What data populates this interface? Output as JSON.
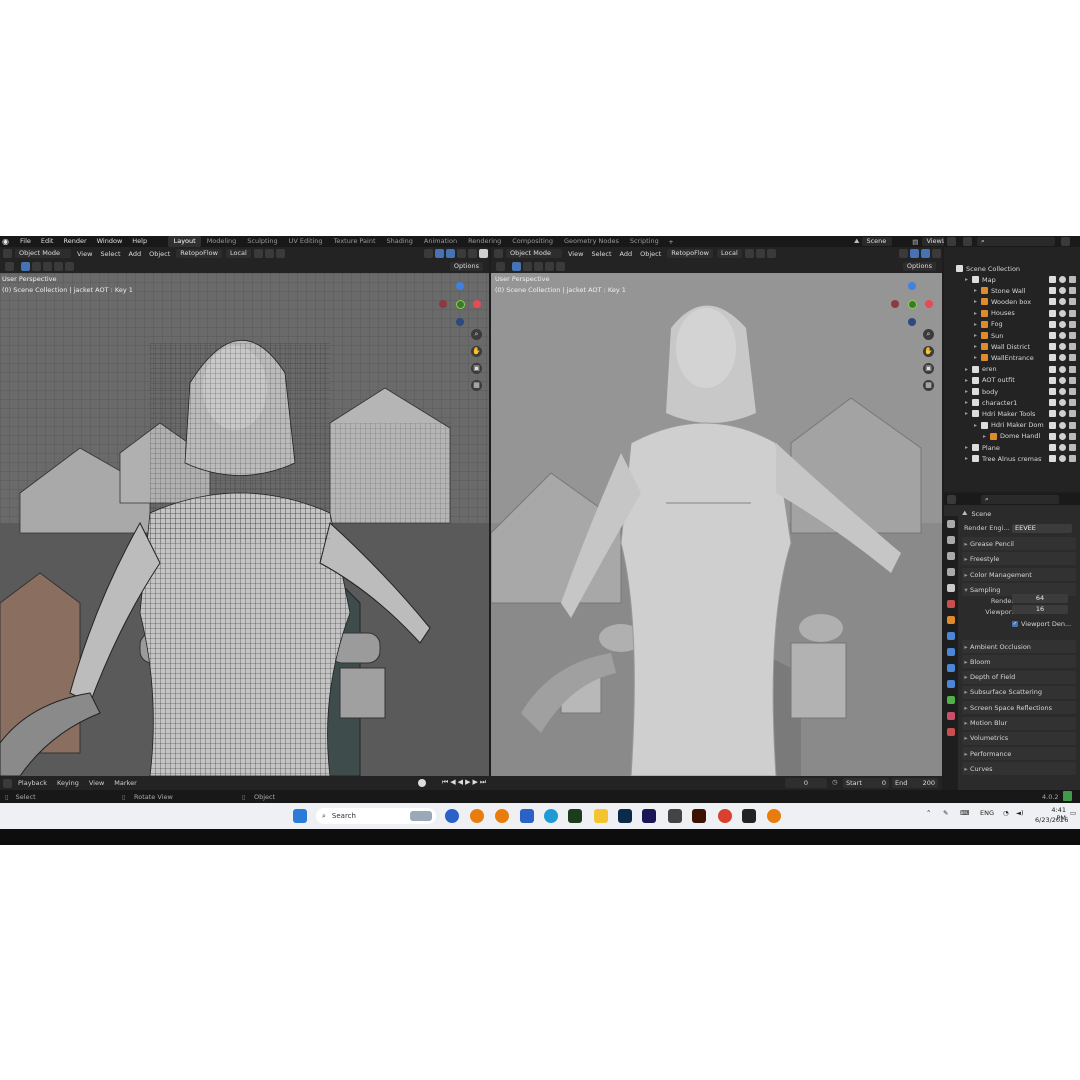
{
  "menu": {
    "items": [
      "File",
      "Edit",
      "Render",
      "Window",
      "Help"
    ],
    "workspaces": [
      "Layout",
      "Modeling",
      "Sculpting",
      "UV Editing",
      "Texture Paint",
      "Shading",
      "Animation",
      "Rendering",
      "Compositing",
      "Geometry Nodes",
      "Scripting"
    ],
    "active_workspace": "Layout",
    "add": "+",
    "scene": "Scene",
    "view_layer": "ViewLayer"
  },
  "viewport_left": {
    "mode": "Object Mode",
    "menu": [
      "View",
      "Select",
      "Add",
      "Object"
    ],
    "addon": "RetopoFlow",
    "transform": "Local",
    "options": "Options",
    "title": "User Perspective",
    "subtitle": "(0) Scene Collection | jacket AOT : Key 1"
  },
  "viewport_right": {
    "mode": "Object Mode",
    "menu": [
      "View",
      "Select",
      "Add",
      "Object"
    ],
    "addon": "RetopoFlow",
    "transform": "Local",
    "options": "Options",
    "title": "User Perspective",
    "subtitle": "(0) Scene Collection | jacket AOT : Key 1"
  },
  "outliner": {
    "root": "Scene Collection",
    "rows": [
      {
        "label": "Map",
        "indent": 1
      },
      {
        "label": "Stone Wall",
        "indent": 2
      },
      {
        "label": "Wooden box",
        "indent": 2
      },
      {
        "label": "Houses",
        "indent": 2
      },
      {
        "label": "Fog",
        "indent": 2
      },
      {
        "label": "Sun",
        "indent": 2
      },
      {
        "label": "Wall District",
        "indent": 2
      },
      {
        "label": "WallEntrance",
        "indent": 2
      },
      {
        "label": "eren",
        "indent": 1
      },
      {
        "label": "AOT outfit",
        "indent": 1
      },
      {
        "label": "body",
        "indent": 1
      },
      {
        "label": "character1",
        "indent": 1
      },
      {
        "label": "Hdri Maker Tools",
        "indent": 1
      },
      {
        "label": "Hdri Maker Dom",
        "indent": 2
      },
      {
        "label": "Dome Handl",
        "indent": 3
      },
      {
        "label": "Plane",
        "indent": 1
      },
      {
        "label": "Tree Alnus cremast",
        "indent": 1
      }
    ]
  },
  "properties": {
    "context": "Scene",
    "render_engine_label": "Render Engi...",
    "render_engine": "EEVEE",
    "panels": [
      "Grease Pencil",
      "Freestyle",
      "Color Management",
      "Sampling"
    ],
    "sampling": {
      "render_label": "Render",
      "render": "64",
      "viewport_label": "Viewport",
      "viewport": "16",
      "denoise": "Viewport Den..."
    },
    "panels2": [
      "Ambient Occlusion",
      "Bloom",
      "Depth of Field",
      "Subsurface Scattering",
      "Screen Space Reflections",
      "Motion Blur",
      "Volumetrics",
      "Performance",
      "Curves"
    ]
  },
  "timeline": {
    "items": [
      "Playback",
      "Keying",
      "View",
      "Marker"
    ],
    "current_frame": "0",
    "start_label": "Start",
    "start": "0",
    "end_label": "End",
    "end": "200"
  },
  "status": {
    "select": "Select",
    "rotate": "Rotate View",
    "object": "Object",
    "version": "4.0.2"
  },
  "taskbar": {
    "search_placeholder": "Search",
    "language": "ENG",
    "time": "4:41 PM",
    "date": "6/23/2026"
  },
  "colors": {
    "accent": "#4772b3",
    "gizmo_x": "#e84b55",
    "gizmo_y": "#8bd24a",
    "gizmo_z": "#3f80e0"
  }
}
